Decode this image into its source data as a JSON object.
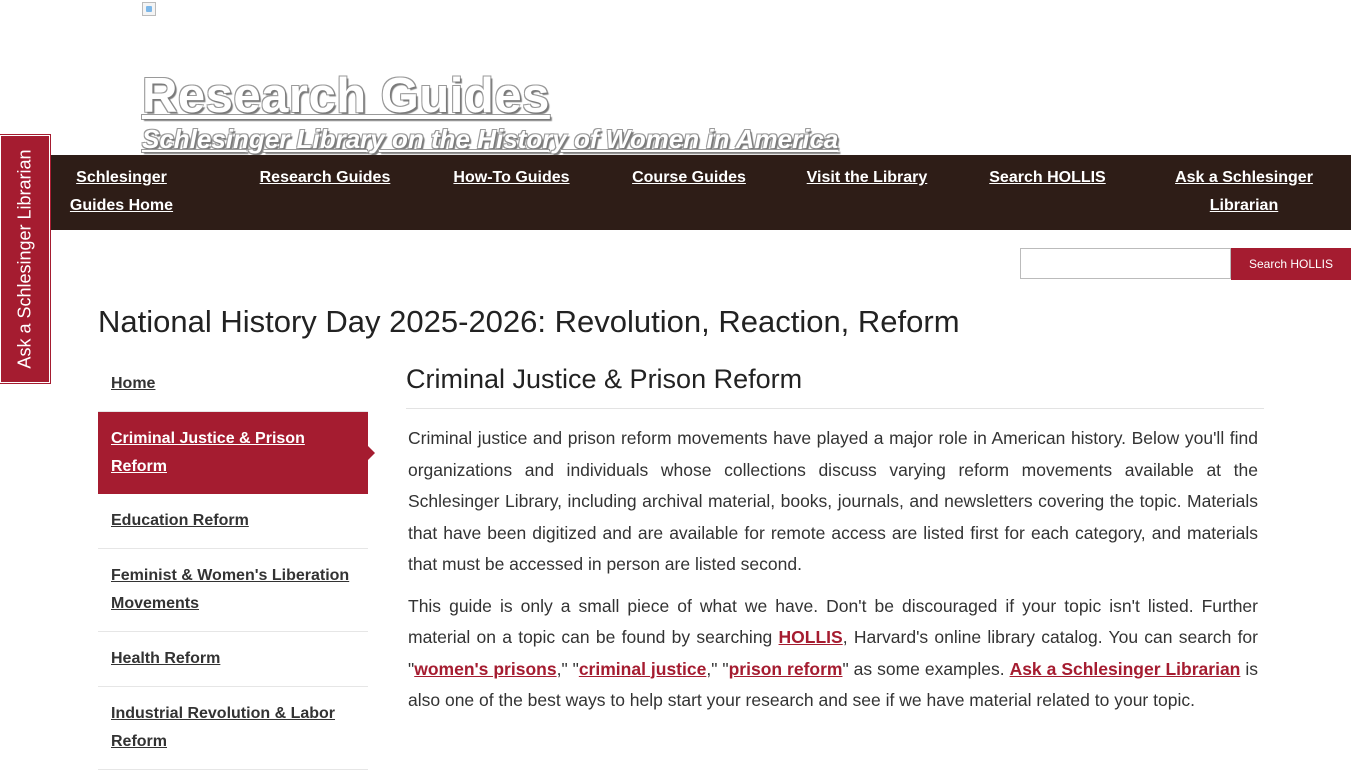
{
  "header": {
    "title": "Research Guides",
    "subtitle": "Schlesinger Library on the History of Women in America"
  },
  "nav": [
    "Schlesinger Guides Home",
    "Research Guides",
    "How-To Guides",
    "Course Guides",
    "Visit the Library",
    "Search HOLLIS",
    "Ask a Schlesinger Librarian"
  ],
  "side_tab": {
    "label": "Ask a Schlesinger Librarian"
  },
  "search": {
    "value": "",
    "button_label": "Search HOLLIS"
  },
  "page_title": "National History Day 2025-2026: Revolution, Reaction, Reform",
  "sidebar": {
    "items": [
      {
        "label": "Home",
        "active": false
      },
      {
        "label": "Criminal Justice & Prison Reform",
        "active": true
      },
      {
        "label": "Education Reform",
        "active": false
      },
      {
        "label": "Feminist & Women's Liberation Movements",
        "active": false
      },
      {
        "label": "Health Reform",
        "active": false
      },
      {
        "label": "Industrial Revolution & Labor Reform",
        "active": false
      }
    ]
  },
  "content": {
    "heading": "Criminal Justice & Prison Reform",
    "p1": "Criminal justice and prison reform movements have played a major role in American history. Below you'll find organizations and individuals whose collections discuss varying reform movements available at the Schlesinger Library, including archival material, books, journals, and newsletters covering the topic. Materials that have been digitized and are available for remote access are listed first for each category, and materials that must be accessed in person are listed second.",
    "p2": {
      "t1": "This guide is only a small piece of what we have. Don't be discouraged if your topic isn't listed. Further material on a topic can be found by searching ",
      "link_hollis": "HOLLIS",
      "t2": ", Harvard's online library catalog. You can search for \"",
      "link_women": "women's prisons",
      "t3": ",\" \"",
      "link_criminal": "criminal justice",
      "t4": ",\" \"",
      "link_prison": "prison reform",
      "t5": "\" as some examples. ",
      "link_ask": "Ask a Schlesinger Librarian",
      "t6": " is also one of the best ways to help start your research and see if we have material related to your topic."
    }
  },
  "colors": {
    "brand_crimson": "#a51c30",
    "nav_background": "#2e1d17"
  }
}
